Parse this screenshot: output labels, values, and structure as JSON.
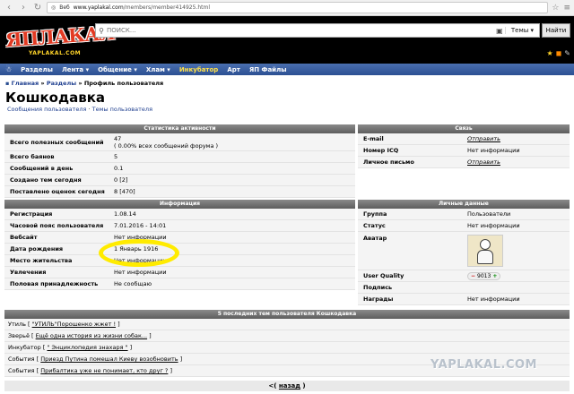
{
  "browser": {
    "tab_label": "Веб",
    "url_domain": "www.yaplakal.com",
    "url_path": "/members/member414925.html"
  },
  "logo": {
    "main": "ЯПЛАКАЛ",
    "sub": "YAPLAKAL.COM"
  },
  "search": {
    "placeholder": "ПОИСК...",
    "select_label": "Темы",
    "button_label": "Найти"
  },
  "nav": {
    "items": [
      "Разделы",
      "Лента",
      "Общение",
      "Хлам",
      "Инкубатор",
      "Арт",
      "ЯП Файлы"
    ]
  },
  "breadcrumb": {
    "home": "Главная",
    "sections": "Разделы",
    "current": "» Профиль пользователя",
    "sep": "»"
  },
  "profile": {
    "name": "Кошкодавка",
    "link_messages": "Сообщения пользователя",
    "link_sep": " · ",
    "link_topics": "Темы пользователя"
  },
  "activity": {
    "title": "Статистика активности",
    "rows": [
      {
        "label": "Всего полезных сообщений",
        "value": "47",
        "sub": "( 0.00% всех сообщений форума )"
      },
      {
        "label": "Всего баянов",
        "value": "5"
      },
      {
        "label": "Сообщений в день",
        "value": "0.1"
      },
      {
        "label": "Создано тем сегодня",
        "value": "0 [2]"
      },
      {
        "label": "Поставлено оценок сегодня",
        "value": "8 [470]"
      }
    ]
  },
  "contact": {
    "title": "Связь",
    "rows": [
      {
        "label": "E-mail",
        "value": "Отправить"
      },
      {
        "label": "Номер ICQ",
        "value": "Нет информации"
      },
      {
        "label": "Личное письмо",
        "value": "Отправить"
      }
    ]
  },
  "info": {
    "title": "Информация",
    "rows": [
      {
        "label": "Регистрация",
        "value": "1.08.14"
      },
      {
        "label": "Часовой пояс пользователя",
        "value": "7.01.2016 - 14:01"
      },
      {
        "label": "Вебсайт",
        "value": "Нет информации"
      },
      {
        "label": "Дата рождения",
        "value": "1 Январь 1916"
      },
      {
        "label": "Место жительства",
        "value": "Нет информации"
      },
      {
        "label": "Увлечения",
        "value": "Нет информации"
      },
      {
        "label": "Половая принадлежность",
        "value": "Не сообщаю"
      }
    ]
  },
  "personal": {
    "title": "Личные данные",
    "rows": [
      {
        "label": "Группа",
        "value": "Пользователи"
      },
      {
        "label": "Статус",
        "value": "Нет информации"
      },
      {
        "label": "Аватар",
        "value": ""
      },
      {
        "label": "User Quality",
        "value": "9013"
      },
      {
        "label": "Подпись",
        "value": ""
      },
      {
        "label": "Награды",
        "value": "Нет информации"
      }
    ]
  },
  "topics": {
    "title": "5 последних тем пользователя Кошкодавка",
    "rows": [
      {
        "section": "Утиль [",
        "topic": "\"УТИЛЬ\"Порошенко жжет !",
        "end": "]"
      },
      {
        "section": "Зверьё [",
        "topic": "Ещё одна история из жизни собак...",
        "end": "]"
      },
      {
        "section": "Инкубатор [",
        "topic": "\" Энциклопедия знахаря \"",
        "end": "]"
      },
      {
        "section": "События [",
        "topic": "Приезд Путина помешал Киеву возобновить",
        "end": "]"
      },
      {
        "section": "События [",
        "topic": "Прибалтика уже не понимает, кто друг ?",
        "end": "]"
      }
    ]
  },
  "pager": {
    "prefix": "<(",
    "link": "назад",
    "suffix": ")"
  },
  "watermark": "YAPLAKAL.COM",
  "colors": {
    "nav_bg": "#2b4f92",
    "panel_head": "#6e6e6e",
    "highlight": "#ffeb00",
    "logo_red": "#e23a23"
  }
}
